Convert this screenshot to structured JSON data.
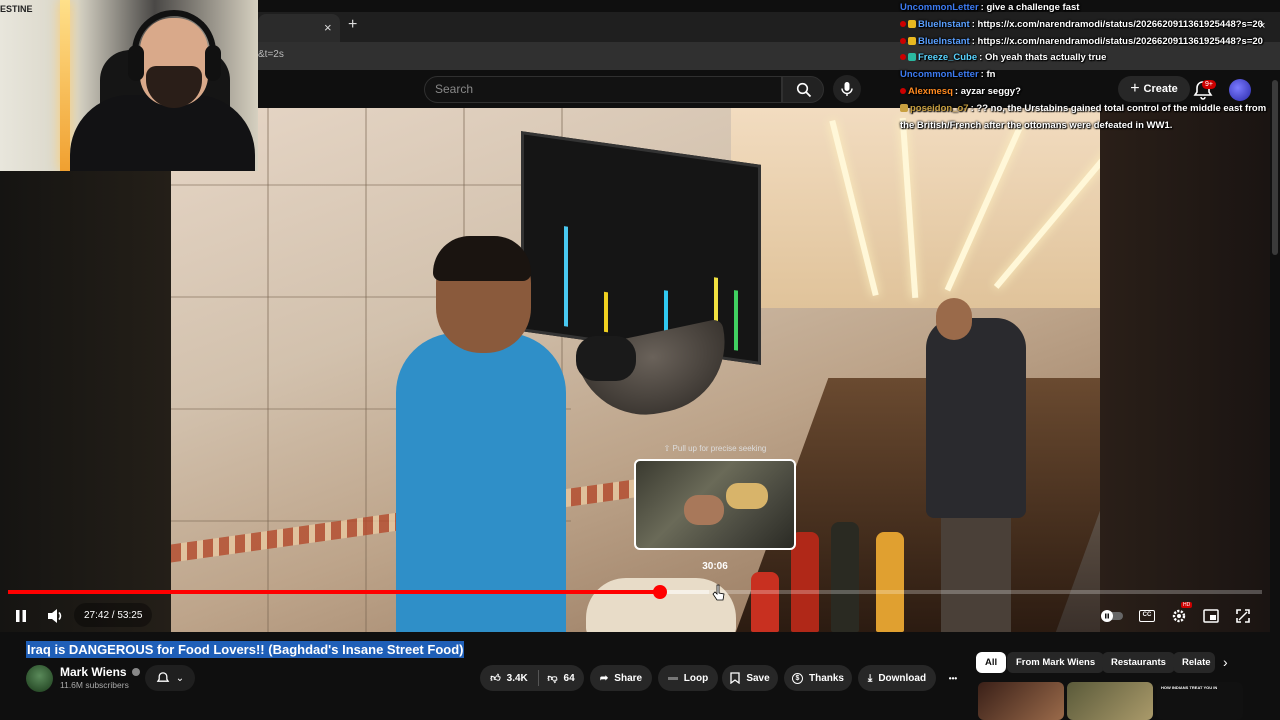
{
  "browser": {
    "tab_close": "×",
    "new_tab": "+",
    "url_fragment": "&t=2s"
  },
  "header": {
    "search_placeholder": "Search",
    "create_label": "Create",
    "notif_badge": "9+",
    "icons": [
      "search-icon",
      "mic-icon",
      "plus-icon",
      "bell-icon"
    ]
  },
  "webcam": {
    "wall_text": "ESTINE"
  },
  "chat": [
    {
      "user": "UncommonLetter",
      "color": "#3d7bf2",
      "text": "give a challenge fast",
      "badge": false,
      "mod": false
    },
    {
      "user": "BlueInstant",
      "color": "#5aa0ff",
      "text": "https://x.com/narendramodi/status/2026620911361925448?s=20",
      "badge": true,
      "badge_color": "#e8b820",
      "mod": true
    },
    {
      "user": "BlueInstant",
      "color": "#5aa0ff",
      "text": "https://x.com/narendramodi/status/2026620911361925448?s=20",
      "badge": true,
      "badge_color": "#e8b820",
      "mod": true
    },
    {
      "user": "Freeze_Cube",
      "color": "#5ad4ff",
      "text": "Oh yeah thats actually true",
      "badge": true,
      "badge_color": "#2ab8a0",
      "mod": true
    },
    {
      "user": "UncommonLetter",
      "color": "#3d7bf2",
      "text": "fn",
      "badge": false,
      "mod": false
    },
    {
      "user": "Alexmesq",
      "color": "#ff8a20",
      "text": "ayzar seggy?",
      "badge": false,
      "mod": true
    },
    {
      "user": "poseidon_o7",
      "color": "#c8a040",
      "text": "?? no, the Urstabins gained total control of the middle east from the British/French after the ottomans were defeated in WW1.",
      "badge": true,
      "badge_color": "#c8a040",
      "mod": false
    }
  ],
  "player": {
    "progress": 0.52,
    "buffered": 0.559,
    "current_time": "27:42",
    "duration": "53:25",
    "time_display": "27:42 / 53:25",
    "seek_hint": "⇧ Pull up for precise seeking",
    "seek_time": "30:06",
    "watermark": "Mark\nWiens",
    "hd_badge": "HD"
  },
  "video_info": {
    "title": "Iraq is DANGEROUS for Food Lovers!! (Baghdad's Insane Street Food)",
    "channel": "Mark Wiens",
    "subscribers": "11.6M subscribers",
    "likes": "3.4K",
    "dislikes": "64",
    "share": "Share",
    "loop": "Loop",
    "save": "Save",
    "thanks": "Thanks",
    "download": "Download",
    "more": "•••"
  },
  "chips": {
    "all": "All",
    "from_channel": "From Mark Wiens",
    "restaurants": "Restaurants",
    "related": "Relate"
  },
  "recommendations": [
    {
      "thumb_color": "#6a3a2a"
    },
    {
      "thumb_color": "#7a6a4a"
    },
    {
      "thumb_color": "#2a2020",
      "caption": "HOW INDIANS TREAT YOU IN"
    }
  ]
}
